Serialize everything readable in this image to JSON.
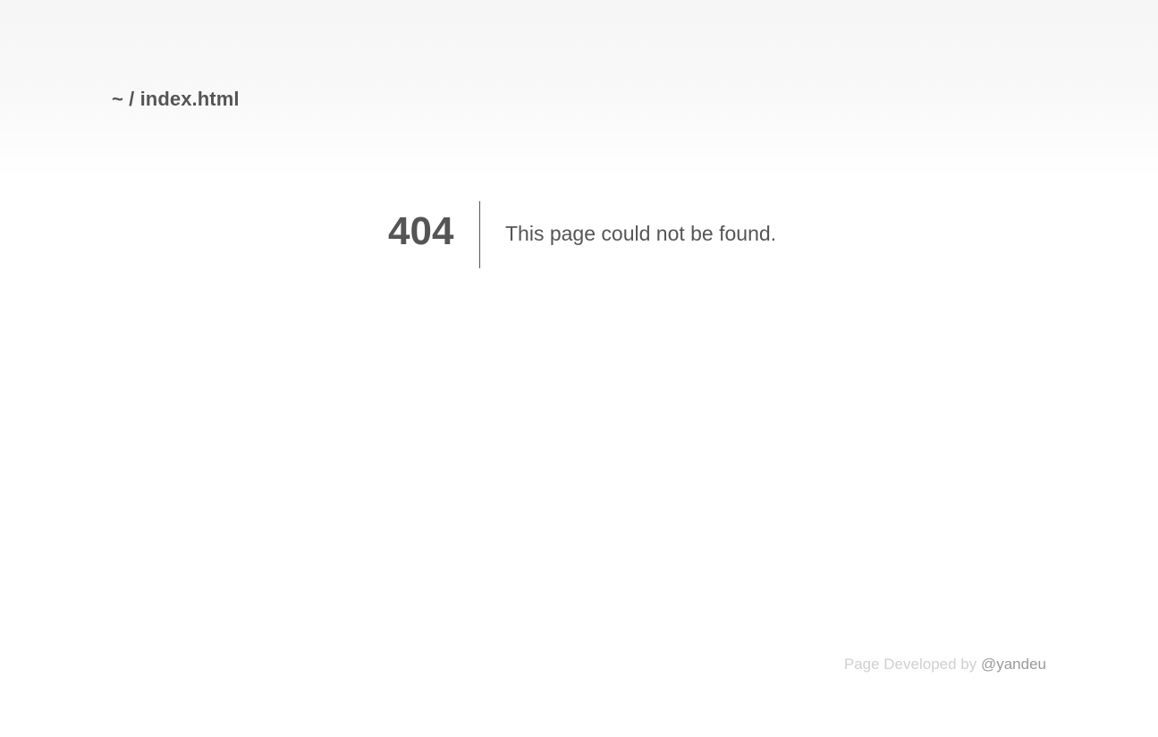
{
  "header": {
    "breadcrumb": "~ / index.html"
  },
  "error": {
    "code": "404",
    "message": "This page could not be found."
  },
  "footer": {
    "prefix": "Page Developed by",
    "author_link": "@yandeu"
  },
  "colors": {
    "text": "#555555",
    "footer_text": "#cfcfcf",
    "footer_link": "#9a9a9a",
    "background": "#ffffff",
    "header_band": "#f6f6f6"
  }
}
